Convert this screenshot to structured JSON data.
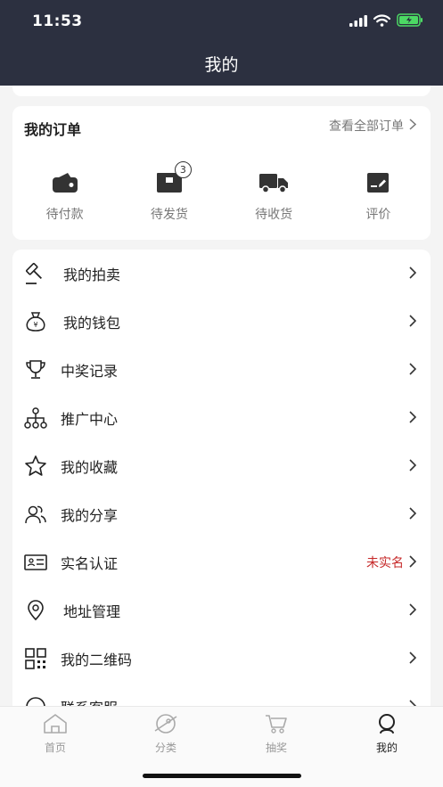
{
  "status_bar": {
    "time": "11:53"
  },
  "header": {
    "title": "我的"
  },
  "orders": {
    "title": "我的订单",
    "view_all": "查看全部订单",
    "items": [
      {
        "label": "待付款",
        "icon": "wallet-icon"
      },
      {
        "label": "待发货",
        "icon": "package-icon",
        "badge": "3"
      },
      {
        "label": "待收货",
        "icon": "truck-icon"
      },
      {
        "label": "评价",
        "icon": "review-icon"
      }
    ]
  },
  "menu": {
    "items": [
      {
        "label": "我的拍卖",
        "icon": "gavel-icon"
      },
      {
        "label": "我的钱包",
        "icon": "money-bag-icon"
      },
      {
        "label": "中奖记录",
        "icon": "trophy-icon"
      },
      {
        "label": "推广中心",
        "icon": "network-icon"
      },
      {
        "label": "我的收藏",
        "icon": "star-icon"
      },
      {
        "label": "我的分享",
        "icon": "users-icon"
      },
      {
        "label": "实名认证",
        "icon": "id-card-icon",
        "status": "未实名"
      },
      {
        "label": "地址管理",
        "icon": "location-icon"
      },
      {
        "label": "我的二维码",
        "icon": "qr-code-icon"
      },
      {
        "label": "联系客服",
        "icon": "headset-icon"
      }
    ]
  },
  "tabbar": {
    "items": [
      {
        "label": "首页",
        "icon": "home-icon"
      },
      {
        "label": "分类",
        "icon": "category-icon"
      },
      {
        "label": "抽奖",
        "icon": "cart-icon"
      },
      {
        "label": "我的",
        "icon": "profile-icon",
        "active": true
      }
    ]
  },
  "colors": {
    "header_bg": "#2c3040",
    "status_red": "#c62828",
    "battery_green": "#4cd964"
  }
}
